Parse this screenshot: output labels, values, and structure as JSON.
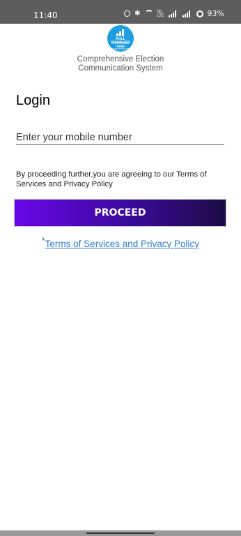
{
  "status_bar": {
    "time": "11:40",
    "volte": "Vo LTE",
    "battery": "93%"
  },
  "header": {
    "logo": {
      "title": "POLL MANAGER",
      "subtitle": "COMPREHENSIVE ELECTION COMMUNICATION SYSTEM",
      "year": "2024"
    },
    "subtitle_line1": "Comprehensive Election",
    "subtitle_line2": "Communication System"
  },
  "login": {
    "title": "Login",
    "mobile_placeholder": "Enter your mobile number",
    "mobile_value": "",
    "consent_text": "By proceeding further,you are agreeing to our Terms of Services and Privacy Policy",
    "proceed_label": "PROCEED",
    "terms_asterisk": "*",
    "terms_link": "Terms of Services and Privacy Policy"
  },
  "colors": {
    "status_bar": "#5d5d5d",
    "button_start": "#6a06e8",
    "button_end": "#1d0a45",
    "link": "#2e7bd1",
    "logo": "#1f9fe0"
  }
}
